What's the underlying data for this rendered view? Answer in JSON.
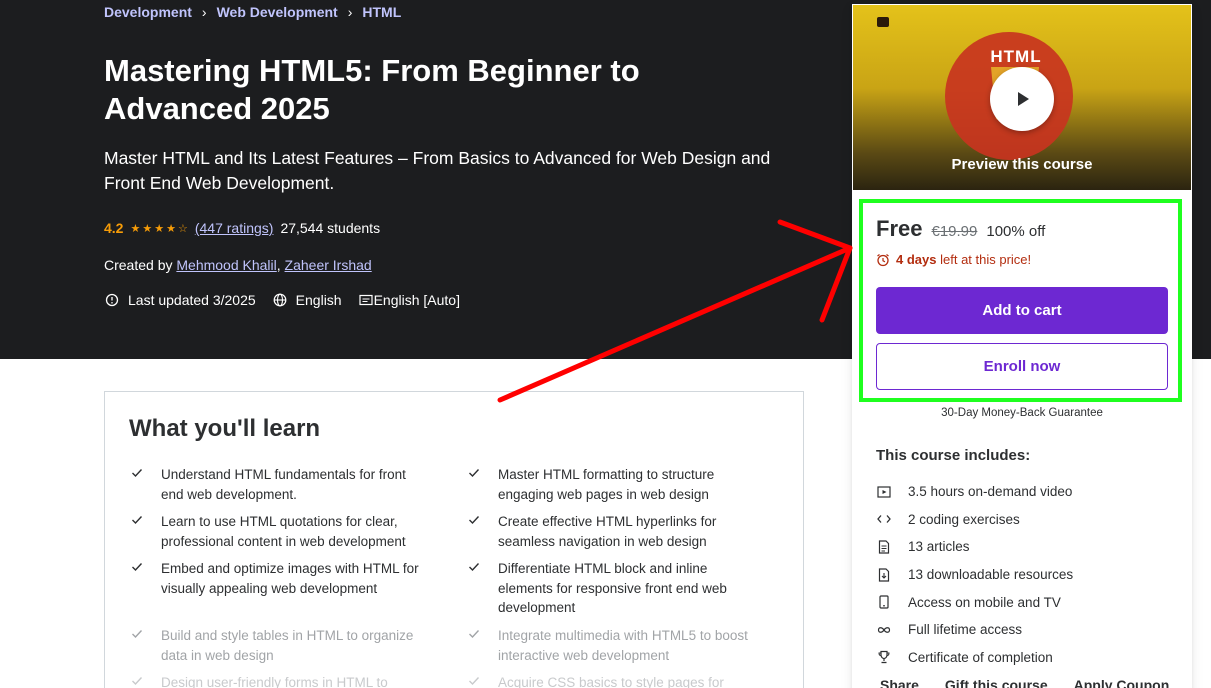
{
  "breadcrumb": [
    "Development",
    "Web Development",
    "HTML"
  ],
  "course": {
    "title": "Mastering HTML5: From Beginner to Advanced 2025",
    "subtitle": "Master HTML and Its Latest Features – From Basics to Advanced for Web Design and Front End Web Development.",
    "rating": "4.2",
    "ratings_count": "(447 ratings)",
    "students": "27,544 students",
    "created_by_label": "Created by",
    "authors": [
      "Mehmood Khalil",
      "Zaheer Irshad"
    ],
    "last_updated": "Last updated 3/2025",
    "language": "English",
    "captions": "English [Auto]"
  },
  "sidebar": {
    "preview_label": "Preview this course",
    "preview_logo": "HTML",
    "price": "Free",
    "original_price": "€19.99",
    "discount": "100% off",
    "countdown_bold": "4 days",
    "countdown_rest": "left at this price!",
    "add_to_cart": "Add to cart",
    "enroll_now": "Enroll now",
    "guarantee": "30-Day Money-Back Guarantee",
    "includes_title": "This course includes:",
    "includes": [
      {
        "icon": "video-icon",
        "text": "3.5 hours on-demand video"
      },
      {
        "icon": "code-icon",
        "text": "2 coding exercises"
      },
      {
        "icon": "article-icon",
        "text": "13 articles"
      },
      {
        "icon": "download-icon",
        "text": "13 downloadable resources"
      },
      {
        "icon": "mobile-icon",
        "text": "Access on mobile and TV"
      },
      {
        "icon": "infinity-icon",
        "text": "Full lifetime access"
      },
      {
        "icon": "trophy-icon",
        "text": "Certificate of completion"
      }
    ],
    "footer_links": [
      "Share",
      "Gift this course",
      "Apply Coupon"
    ]
  },
  "learn": {
    "title": "What you'll learn",
    "items": [
      "Understand HTML fundamentals for front end web development.",
      "Master HTML formatting to structure engaging web pages in web design",
      "Learn to use HTML quotations for clear, professional content in web development",
      "Create effective HTML hyperlinks for seamless navigation in web design",
      "Embed and optimize images with HTML for visually appealing web development",
      "Differentiate HTML block and inline elements for responsive front end web development",
      "Build and style tables in HTML to organize data in web design",
      "Integrate multimedia with HTML5 to boost interactive web development",
      "Design user-friendly forms in HTML to",
      "Acquire CSS basics to style pages for"
    ]
  },
  "colors": {
    "hero_bg": "#1c1d1f",
    "brand_purple": "#6d28d2",
    "link_lavender": "#c0c4fc",
    "rating_orange": "#f69c08",
    "countdown_red": "#b32d0f",
    "highlight_green": "#1fff1f",
    "arrow_red": "#ff0000"
  }
}
